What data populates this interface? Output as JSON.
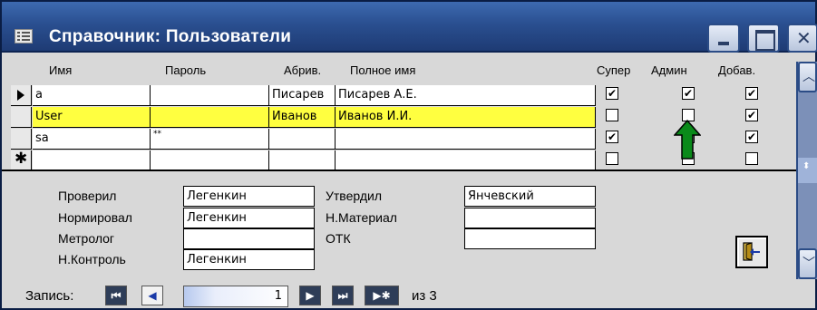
{
  "window": {
    "title": "Справочник: Пользователи",
    "close_glyph": "✕",
    "colors": {
      "titlebar": "#2a4f90",
      "selected_row": "#ffff40",
      "background": "#d8d8d8"
    }
  },
  "grid": {
    "columns": {
      "name": "Имя",
      "password": "Пароль",
      "abbrev": "Абрив.",
      "fullname": "Полное имя",
      "super": "Супер",
      "admin": "Админ",
      "add": "Добав."
    },
    "rows": [
      {
        "selector": "current",
        "name": "a",
        "password": "",
        "abbrev": "Писарев",
        "fullname": "Писарев А.Е.",
        "super": true,
        "admin": true,
        "add": true
      },
      {
        "selector": "",
        "name": "User",
        "password": "",
        "abbrev": "Иванов",
        "fullname": "Иванов И.И.",
        "super": false,
        "admin": false,
        "add": true
      },
      {
        "selector": "",
        "name": "sa",
        "password": "**",
        "abbrev": "",
        "fullname": "",
        "super": true,
        "admin": false,
        "add": true
      },
      {
        "selector": "new",
        "name": "",
        "password": "",
        "abbrev": "",
        "fullname": "",
        "super": false,
        "admin": false,
        "add": false
      }
    ],
    "new_row_glyph": "✱"
  },
  "form": {
    "checked_label": "Проверил",
    "checked_value": "Легенкин",
    "normcontrol_label": "Нормировал",
    "normcontrol_value": "Легенкин",
    "metrologist_label": "Метролог",
    "metrologist_value": "",
    "ncontrol_label": "Н.Контроль",
    "ncontrol_value": "Легенкин",
    "approved_label": "Утвердил",
    "approved_value": "Янчевский",
    "hmaterial_label": "Н.Материал",
    "hmaterial_value": "",
    "otk_label": "ОТК",
    "otk_value": ""
  },
  "navigation": {
    "record_label": "Запись:",
    "current_record": "1",
    "of_label": "из  3",
    "first": "⏮",
    "prev": "◀",
    "next": "▶",
    "last": "⏭",
    "new": "▶✱"
  },
  "icons": {
    "exit": "exit-door-icon",
    "arrow": "green-up-arrow-icon"
  }
}
